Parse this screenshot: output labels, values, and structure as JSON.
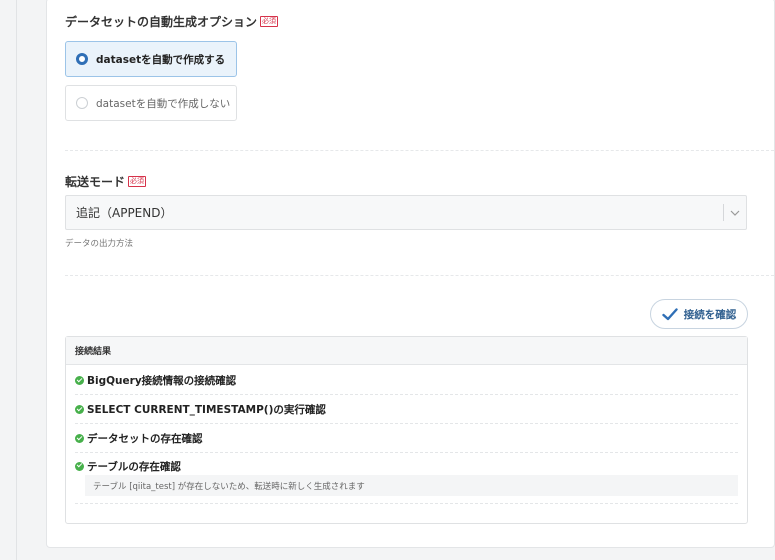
{
  "dataset_option": {
    "label": "データセットの自動生成オプション",
    "required": "必須",
    "options": [
      {
        "label": "datasetを自動で作成する",
        "selected": true
      },
      {
        "label": "datasetを自動で作成しない",
        "selected": false
      }
    ]
  },
  "transfer_mode": {
    "label": "転送モード",
    "required": "必須",
    "value": "追記（APPEND）",
    "help": "データの出力方法"
  },
  "check_button": {
    "label": "接続を確認",
    "icon": "check-icon"
  },
  "results": {
    "title": "接続結果",
    "items": [
      {
        "text": "BigQuery接続情報の接続確認",
        "status": "ok"
      },
      {
        "text": "SELECT CURRENT_TIMESTAMP()の実行確認",
        "status": "ok"
      },
      {
        "text": "データセットの存在確認",
        "status": "ok"
      },
      {
        "text": "テーブルの存在確認",
        "status": "ok"
      }
    ],
    "note": "テーブル [qiita_test] が存在しないため、転送時に新しく生成されます"
  },
  "colors": {
    "accent": "#2f6fb6",
    "success": "#47b04b",
    "required": "#d6324a"
  }
}
